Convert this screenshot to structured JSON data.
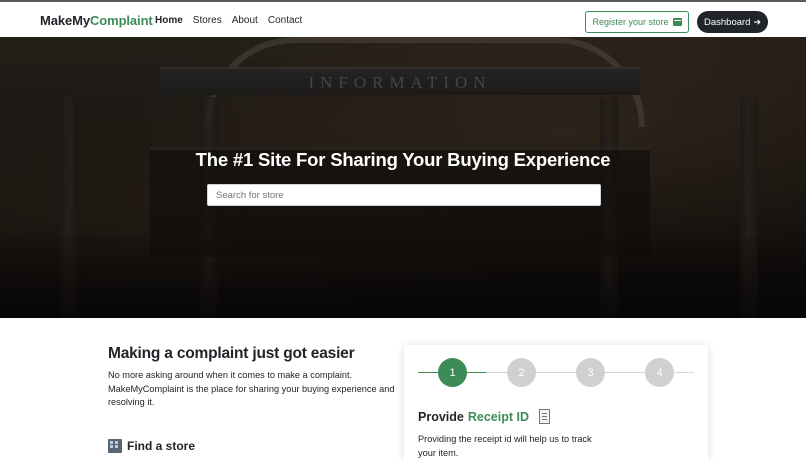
{
  "navbar": {
    "brand_part1": "MakeMy",
    "brand_part2": "Complaint",
    "links": [
      "Home",
      "Stores",
      "About",
      "Contact"
    ],
    "active_link": "Home",
    "register_label": "Register your store",
    "dashboard_label": "Dashboard"
  },
  "hero": {
    "sign_text": "INFORMATION",
    "title": "The #1 Site For Sharing Your Buying Experience",
    "search_placeholder": "Search for store"
  },
  "intro": {
    "heading": "Making a complaint just got easier",
    "body": "No more asking around when it comes to make a complaint. MakeMyComplaint is the place for sharing your buying experience and resolving it.",
    "find_store_label": "Find a store"
  },
  "steps_card": {
    "steps": [
      "1",
      "2",
      "3",
      "4"
    ],
    "active_step": "1",
    "title_prefix": "Provide",
    "title_accent": "Receipt ID",
    "text": "Providing the receipt id will help us to track your item."
  },
  "colors": {
    "accent": "#3d8b57",
    "dark": "#212529",
    "step_inactive": "#d0d0d0"
  },
  "icons": [
    "store-icon",
    "sign-in-icon",
    "building-icon",
    "receipt-icon"
  ]
}
